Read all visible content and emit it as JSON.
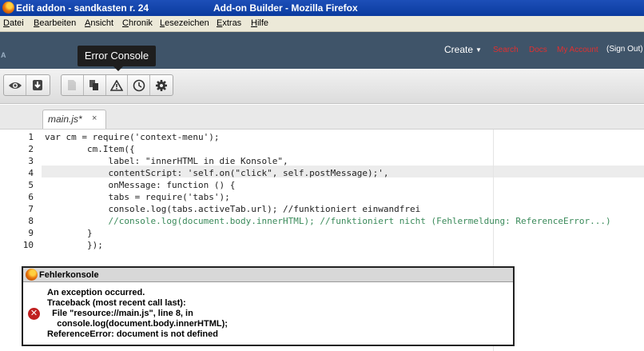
{
  "window": {
    "title": "Edit addon - sandkasten r. 24",
    "app_title": "Add-on Builder - Mozilla Firefox"
  },
  "menubar": [
    "Datei",
    "Bearbeiten",
    "Ansicht",
    "Chronik",
    "Lesezeichen",
    "Extras",
    "Hilfe"
  ],
  "header": {
    "create": "Create",
    "search": "Search",
    "docs": "Docs",
    "my_account": "My Account",
    "sign_out": "(Sign Out)",
    "link_color": "#e03030"
  },
  "tooltip": "Error Console",
  "toolbar": {
    "icons": [
      "eye-icon",
      "download-icon",
      "document-icon",
      "copy-icon",
      "warning-icon",
      "clock-icon",
      "gear-icon"
    ]
  },
  "editor": {
    "tab_label": "main.js*",
    "tab_close": "×",
    "lines": [
      {
        "n": "1",
        "text": "var cm = require('context-menu');"
      },
      {
        "n": "2",
        "text": "        cm.Item({"
      },
      {
        "n": "3",
        "text": "            label: \"innerHTML in die Konsole\","
      },
      {
        "n": "4",
        "text": "            contentScript: 'self.on(\"click\", self.postMessage);',"
      },
      {
        "n": "5",
        "text": "            onMessage: function () {"
      },
      {
        "n": "6",
        "text": "            tabs = require('tabs');"
      },
      {
        "n": "7",
        "text": "            console.log(tabs.activeTab.url); //funktioniert einwandfrei"
      },
      {
        "n": "8",
        "text": "            //console.log(document.body.innerHTML); //funktioniert nicht (Fehlermeldung: ReferenceError...)"
      },
      {
        "n": "9",
        "text": "        }"
      },
      {
        "n": "10",
        "text": "        });"
      }
    ]
  },
  "error_console": {
    "title": "Fehlerkonsole",
    "lines": [
      "An exception occurred.",
      "Traceback (most recent call last):",
      "  File \"resource://main.js\", line 8, in",
      "    console.log(document.body.innerHTML);",
      "ReferenceError: document is not defined"
    ]
  }
}
